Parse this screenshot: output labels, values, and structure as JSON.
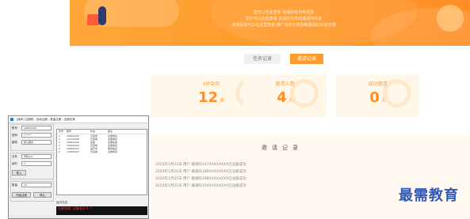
{
  "hero": {
    "lines": [
      "您可以在此查看 完成的任务和奖励",
      "您还可以在此查看 完成的任务和邀请的好友",
      "完成后还可以在这里查看 推广任务的奖励和邀请的好友记录"
    ]
  },
  "tabs": [
    {
      "label": "任务记录"
    },
    {
      "label": "邀请记录"
    }
  ],
  "stats": [
    {
      "title": "VIP会员",
      "value": "12",
      "unit": "天"
    },
    {
      "title": "邀请人数",
      "value": "4",
      "unit": "人"
    },
    {
      "title": "成功邀请",
      "value": "0",
      "unit": "人"
    }
  ],
  "panel": {
    "title": "邀请记录",
    "rows": [
      "2020年1月21日 用户 邀请码147XXXXXXXX已注册成功",
      "2020年1月21日 用户 邀请码186XXXXXXXX已注册成功",
      "2020年1月21日 用户 邀请码188XXXXXXXX已注册成功",
      "2020年1月21日 用户 邀请码150XXXXXXXX已注册成功"
    ]
  },
  "watermark": "最需教育",
  "app": {
    "title": "[版本] 注册机 - 自动注册 - 批量注册 - 注册记录",
    "labels": {
      "acct": "账号",
      "pwd": "密码",
      "server": "服务",
      "file": "文件",
      "import_btn": "导入",
      "start_btn": "开始注册",
      "stop_btn": "停止",
      "log_label": "运行日志",
      "delay": "延时",
      "count": "数量"
    },
    "fields": {
      "acct": "186XXXX8",
      "pwd": "******",
      "server": "默认服务",
      "file": "号码.txt",
      "delay": "3",
      "count": "10"
    },
    "window_tabs": [
      "任务",
      "结果",
      "导入数据",
      "设置",
      "帮助"
    ],
    "list_headers": [
      "序号",
      "账号",
      "状态",
      "备注"
    ],
    "list_rows": [
      [
        "1",
        "186XXXX5",
        "已完成",
        "注册成功"
      ],
      [
        "2",
        "147XXXX8",
        "已完成",
        "注册成功"
      ],
      [
        "3",
        "188XXXX2",
        "失败",
        "注册失败"
      ],
      [
        "4",
        "150XXXX6",
        "已完成",
        "注册成功"
      ],
      [
        "5",
        "186XXXX1",
        "运行中",
        "等待验证"
      ],
      [
        "6",
        "139XXXX7",
        "已完成",
        "注册成功"
      ]
    ],
    "log_text": "注册完成: 注册成功 4 个"
  }
}
